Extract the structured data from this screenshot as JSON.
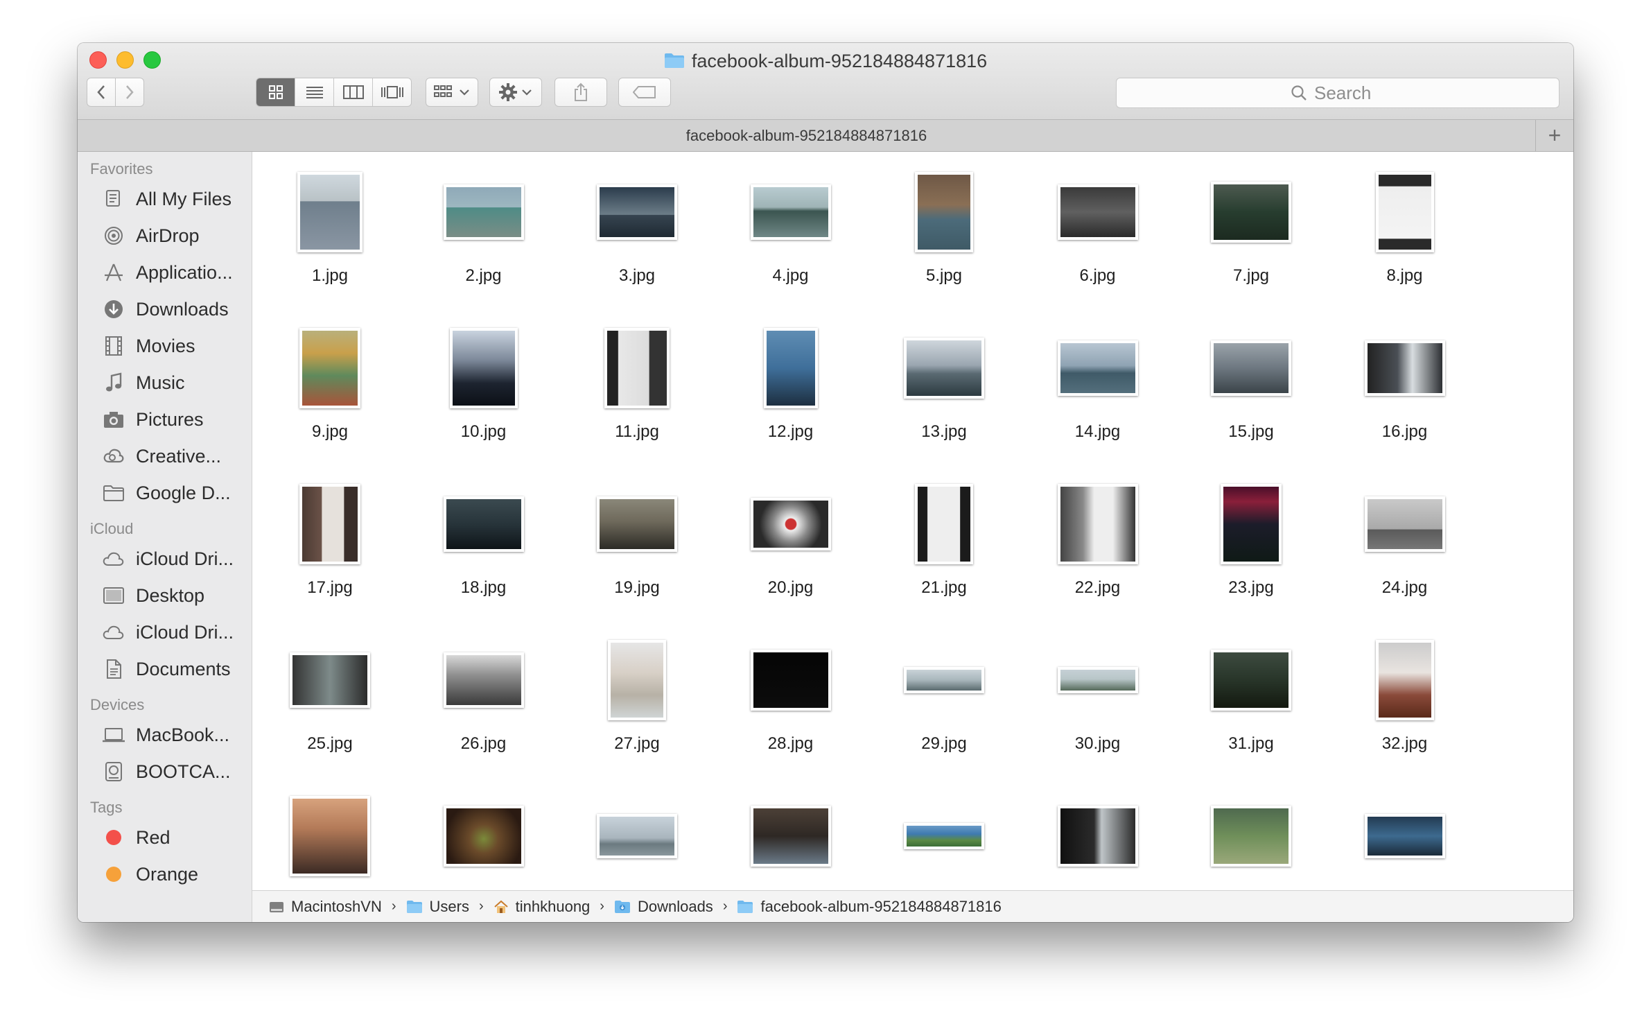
{
  "window": {
    "title": "facebook-album-952184884871816"
  },
  "toolbar": {
    "back_icon": "chevron-left-icon",
    "forward_icon": "chevron-right-icon",
    "view_modes": [
      "icon-view",
      "list-view",
      "column-view",
      "cover-flow-view"
    ],
    "active_view": "icon-view",
    "search_placeholder": "Search"
  },
  "tab": {
    "label": "facebook-album-952184884871816"
  },
  "sidebar": {
    "sections": [
      {
        "title": "Favorites",
        "items": [
          {
            "label": "All My Files",
            "icon": "all-files-icon"
          },
          {
            "label": "AirDrop",
            "icon": "airdrop-icon"
          },
          {
            "label": "Applicatio...",
            "icon": "applications-icon"
          },
          {
            "label": "Downloads",
            "icon": "downloads-icon"
          },
          {
            "label": "Movies",
            "icon": "movies-icon"
          },
          {
            "label": "Music",
            "icon": "music-icon"
          },
          {
            "label": "Pictures",
            "icon": "pictures-icon"
          },
          {
            "label": "Creative...",
            "icon": "creative-cloud-icon"
          },
          {
            "label": "Google D...",
            "icon": "folder-icon"
          }
        ]
      },
      {
        "title": "iCloud",
        "items": [
          {
            "label": "iCloud Dri...",
            "icon": "cloud-icon"
          },
          {
            "label": "Desktop",
            "icon": "desktop-icon"
          },
          {
            "label": "iCloud Dri...",
            "icon": "cloud-icon"
          },
          {
            "label": "Documents",
            "icon": "documents-icon"
          }
        ]
      },
      {
        "title": "Devices",
        "items": [
          {
            "label": "MacBook...",
            "icon": "laptop-icon"
          },
          {
            "label": "BOOTCA...",
            "icon": "disk-icon"
          }
        ]
      },
      {
        "title": "Tags",
        "items": [
          {
            "label": "Red",
            "icon": "tag-dot-icon",
            "color": "#f3504a"
          },
          {
            "label": "Orange",
            "icon": "tag-dot-icon",
            "color": "#f6a13a"
          }
        ]
      }
    ]
  },
  "files": [
    {
      "name": "1.jpg"
    },
    {
      "name": "2.jpg"
    },
    {
      "name": "3.jpg"
    },
    {
      "name": "4.jpg"
    },
    {
      "name": "5.jpg"
    },
    {
      "name": "6.jpg"
    },
    {
      "name": "7.jpg"
    },
    {
      "name": "8.jpg"
    },
    {
      "name": "9.jpg"
    },
    {
      "name": "10.jpg"
    },
    {
      "name": "11.jpg"
    },
    {
      "name": "12.jpg"
    },
    {
      "name": "13.jpg"
    },
    {
      "name": "14.jpg"
    },
    {
      "name": "15.jpg"
    },
    {
      "name": "16.jpg"
    },
    {
      "name": "17.jpg"
    },
    {
      "name": "18.jpg"
    },
    {
      "name": "19.jpg"
    },
    {
      "name": "20.jpg"
    },
    {
      "name": "21.jpg"
    },
    {
      "name": "22.jpg"
    },
    {
      "name": "23.jpg"
    },
    {
      "name": "24.jpg"
    },
    {
      "name": "25.jpg"
    },
    {
      "name": "26.jpg"
    },
    {
      "name": "27.jpg"
    },
    {
      "name": "28.jpg"
    },
    {
      "name": "29.jpg"
    },
    {
      "name": "30.jpg"
    },
    {
      "name": "31.jpg"
    },
    {
      "name": "32.jpg"
    },
    {
      "name": ""
    },
    {
      "name": ""
    },
    {
      "name": ""
    },
    {
      "name": ""
    },
    {
      "name": ""
    },
    {
      "name": ""
    },
    {
      "name": ""
    },
    {
      "name": ""
    }
  ],
  "path": [
    {
      "label": "MacintoshVN",
      "icon": "hard-drive-icon"
    },
    {
      "label": "Users",
      "icon": "folder-icon"
    },
    {
      "label": "tinhkhuong",
      "icon": "home-icon"
    },
    {
      "label": "Downloads",
      "icon": "downloads-folder-icon"
    },
    {
      "label": "facebook-album-952184884871816",
      "icon": "folder-icon"
    }
  ]
}
